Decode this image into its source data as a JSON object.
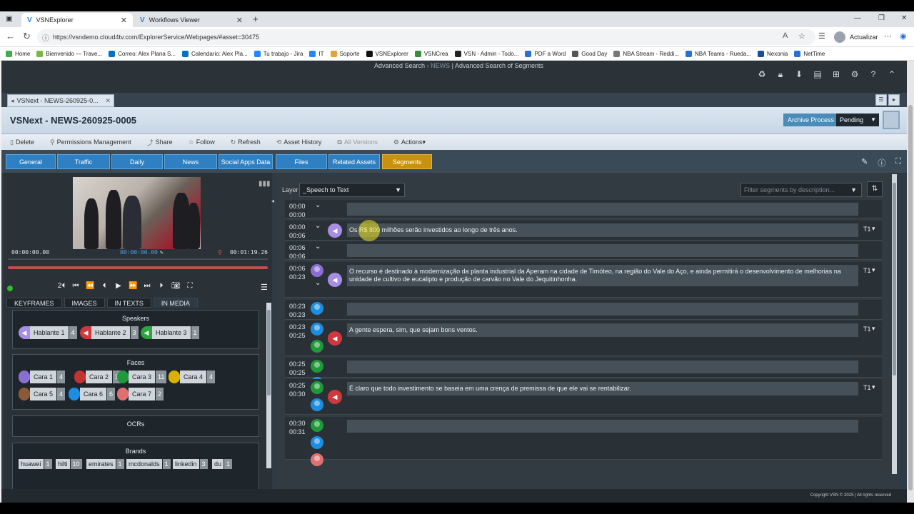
{
  "browser": {
    "tabs": [
      {
        "label": "VSNExplorer",
        "active": true
      },
      {
        "label": "Workflows Viewer",
        "active": false
      }
    ],
    "new_tab": "+",
    "url": "https://vsndemo.cloud4tv.com/ExplorerService/Webpages/#asset=30475",
    "update_label": "Actualizar",
    "bookmarks": [
      {
        "label": "Home",
        "color": "#3fae49"
      },
      {
        "label": "Bienvenido — Trave...",
        "color": "#7ab648"
      },
      {
        "label": "Correo: Alex Plana S...",
        "color": "#0072c6"
      },
      {
        "label": "Calendario: Alex Pla...",
        "color": "#0072c6"
      },
      {
        "label": "Tu trabajo - Jira",
        "color": "#2684ff"
      },
      {
        "label": "IT",
        "color": "#2684ff"
      },
      {
        "label": "Soporte",
        "color": "#e8a23c"
      },
      {
        "label": "VSNExplorer",
        "color": "#111"
      },
      {
        "label": "VSNCrea",
        "color": "#3a8d3a"
      },
      {
        "label": "VSN - Admin - Todo...",
        "color": "#222"
      },
      {
        "label": "PDF a Word",
        "color": "#2b6fd6"
      },
      {
        "label": "Good Day",
        "color": "#555"
      },
      {
        "label": "NBA Stream - Reddi...",
        "color": "#777"
      },
      {
        "label": "NBA Teams - Rueda...",
        "color": "#2b6fd6"
      },
      {
        "label": "Nexonia",
        "color": "#1a4e9a"
      },
      {
        "label": "NetTime",
        "color": "#2b6fd6"
      }
    ]
  },
  "header": {
    "crumb_1": "Advanced Search",
    "crumb_sep": "›",
    "crumb_2": "NEWS",
    "crumb_3": "Advanced Search of Segments"
  },
  "asset_tab": {
    "label": "VSNext - NEWS-260925-0..."
  },
  "asset": {
    "title": "VSNext - NEWS-260925-0005",
    "archive_label": "Archive Process",
    "status": "Pending"
  },
  "actions": [
    {
      "label": "Delete",
      "icon": "▯"
    },
    {
      "label": "Permissions Management",
      "icon": "⚲"
    },
    {
      "label": "Share",
      "icon": "⤴"
    },
    {
      "label": "Follow",
      "icon": "☆"
    },
    {
      "label": "Refresh",
      "icon": "↻"
    },
    {
      "label": "Asset History",
      "icon": "⟲"
    },
    {
      "label": "All Versions",
      "icon": "⧉"
    },
    {
      "label": "Actions",
      "icon": "⚙"
    }
  ],
  "main_tabs": [
    "General",
    "Traffic",
    "Daily",
    "News",
    "Social Apps Data",
    "Files",
    "Related Assets",
    "Segments"
  ],
  "player": {
    "time_start": "00:00:00.00",
    "time_current": "00:00:00.00",
    "time_end": "00:01:19.26"
  },
  "sub_tabs": [
    "KEYFRAMES",
    "IMAGES",
    "IN TEXTS",
    "IN MEDIA"
  ],
  "speakers": {
    "title": "Speakers",
    "items": [
      {
        "label": "Hablante 1",
        "count": "4",
        "color": "#a58ee3"
      },
      {
        "label": "Hablante 2",
        "count": "3",
        "color": "#d0383b"
      },
      {
        "label": "Hablante 3",
        "count": "1",
        "color": "#2aa63a"
      }
    ]
  },
  "faces": {
    "title": "Faces",
    "items": [
      {
        "label": "Cara 1",
        "count": "4",
        "color": "#8a6fd3"
      },
      {
        "label": "Cara 2",
        "count": "3",
        "color": "#c3332f"
      },
      {
        "label": "Cara 3",
        "count": "11",
        "color": "#1f9a3a"
      },
      {
        "label": "Cara 4",
        "count": "4",
        "color": "#d9b200"
      },
      {
        "label": "Cara 5",
        "count": "4",
        "color": "#8a5a36"
      },
      {
        "label": "Cara 6",
        "count": "6",
        "color": "#1c8de0"
      },
      {
        "label": "Cara 7",
        "count": "2",
        "color": "#e07070"
      }
    ]
  },
  "ocrs": {
    "title": "OCRs"
  },
  "brands": {
    "title": "Brands",
    "items": [
      {
        "label": "huawei",
        "count": "1"
      },
      {
        "label": "hilti",
        "count": "10"
      },
      {
        "label": "emirates",
        "count": "1"
      },
      {
        "label": "mcdonalds",
        "count": "1"
      },
      {
        "label": "linkedin",
        "count": "3"
      },
      {
        "label": "du",
        "count": "1"
      }
    ]
  },
  "segments_panel": {
    "layer_label": "Layer",
    "layer_value": "_Speech to Text",
    "filter_placeholder": "Filter segments by description...",
    "track_label": "T1",
    "segments": [
      {
        "t1": "00:00",
        "t2": "00:00",
        "text": ""
      },
      {
        "t1": "00:00",
        "t2": "00:06",
        "text": "Os R$ 800 milhões serão investidos ao longo de três anos."
      },
      {
        "t1": "00:06",
        "t2": "00:06",
        "text": ""
      },
      {
        "t1": "00:06",
        "t2": "00:23",
        "text": "O recurso é destinado à modernização da planta industrial da Aperam na cidade de Timóteo, na região do Vale do Aço, e ainda permitirá o desenvolvimento de melhorias na unidade de cultivo de eucalipto e produção de carvão no Vale do Jequitinhonha."
      },
      {
        "t1": "00:23",
        "t2": "00:23",
        "text": ""
      },
      {
        "t1": "00:23",
        "t2": "00:25",
        "text": "A gente espera, sim, que sejam bons ventos."
      },
      {
        "t1": "00:25",
        "t2": "00:25",
        "text": ""
      },
      {
        "t1": "00:25",
        "t2": "00:30",
        "text": "É claro que todo investimento se baseia em uma crença de premissa de que ele vai se rentabilizar."
      },
      {
        "t1": "00:30",
        "t2": "00:31",
        "text": ""
      }
    ]
  },
  "footer": {
    "copyright": "Copyright VSN © 2025 | All rights reserved"
  }
}
